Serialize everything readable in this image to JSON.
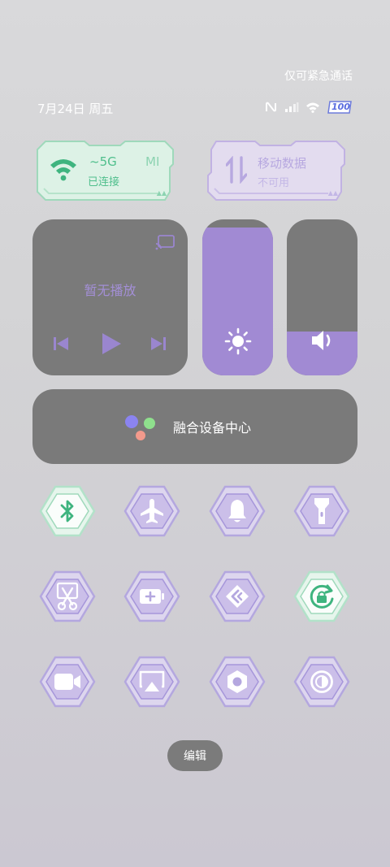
{
  "status": {
    "emergency_text": "仅可紧急通话",
    "date": "7月24日 周五",
    "battery_text": "100"
  },
  "wlan": {
    "ssid": "~5G",
    "ssid_suffix": "MI",
    "state": "已连接"
  },
  "mobile_data": {
    "title": "移动数据",
    "state": "不可用"
  },
  "media": {
    "title": "暂无播放"
  },
  "brightness": {
    "level": 0.95
  },
  "volume": {
    "level": 0.28
  },
  "device_hub": {
    "label": "融合设备中心"
  },
  "edit_label": "编辑",
  "colors": {
    "accent": "#a18ad3",
    "active_green": "#3fb47f",
    "panel": "#7a7a7a",
    "tile_purple": "#b4a7df"
  },
  "toggles": [
    {
      "name": "bluetooth-toggle",
      "icon": "bluetooth-icon",
      "active": true
    },
    {
      "name": "airplane-mode-toggle",
      "icon": "airplane-icon",
      "active": false
    },
    {
      "name": "ringer-toggle",
      "icon": "bell-icon",
      "active": false
    },
    {
      "name": "flashlight-toggle",
      "icon": "flashlight-icon",
      "active": false
    },
    {
      "name": "screenshot-toggle",
      "icon": "scissors-icon",
      "active": false
    },
    {
      "name": "battery-saver-toggle",
      "icon": "battery-plus-icon",
      "active": false
    },
    {
      "name": "nearby-share-toggle",
      "icon": "share-arrows-icon",
      "active": false
    },
    {
      "name": "rotation-lock-toggle",
      "icon": "rotation-lock-icon",
      "active": true
    },
    {
      "name": "screen-record-toggle",
      "icon": "video-camera-icon",
      "active": false
    },
    {
      "name": "cast-toggle",
      "icon": "cast-screen-icon",
      "active": false
    },
    {
      "name": "settings-toggle",
      "icon": "hex-nut-icon",
      "active": false
    },
    {
      "name": "dark-mode-toggle",
      "icon": "contrast-icon",
      "active": false
    }
  ]
}
